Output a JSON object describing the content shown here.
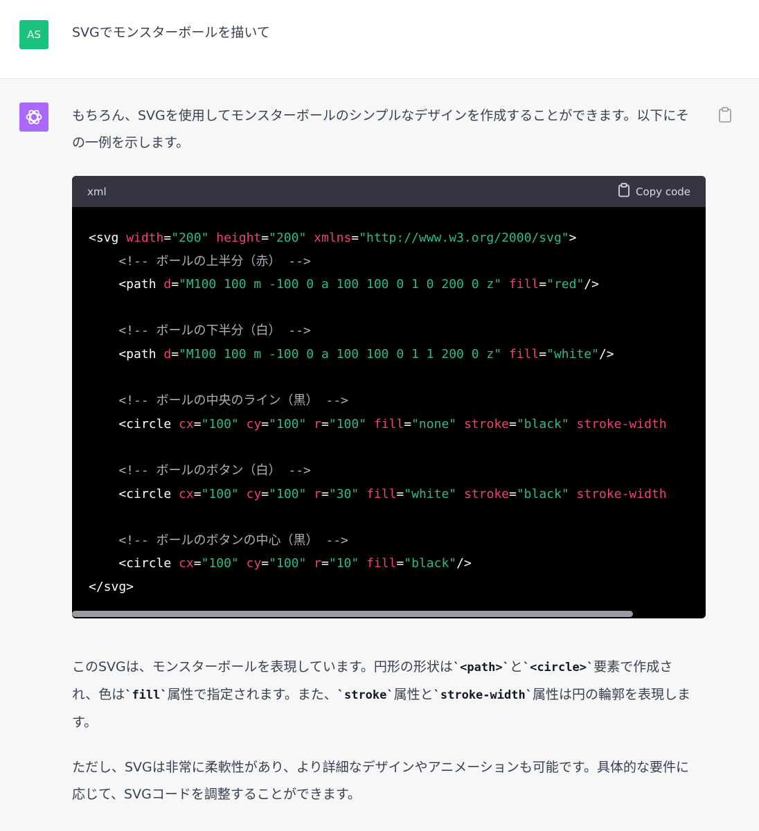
{
  "user": {
    "initials": "AS",
    "message": "SVGでモンスターボールを描いて"
  },
  "assistant": {
    "intro": "もちろん、SVGを使用してモンスターボールのシンプルなデザインを作成することができます。以下にその一例を示します。",
    "code_block": {
      "language": "xml",
      "copy_label": "Copy code"
    },
    "para2_parts": [
      "このSVGは、モンスターボールを表現しています。円形の形状は",
      "`<path>`",
      "と",
      "`<circle>`",
      "要素で作成され、色は",
      "`fill`",
      "属性で指定されます。また、",
      "`stroke`",
      "属性と",
      "`stroke-width`",
      "属性は円の輪郭を表現します。"
    ],
    "para3": "ただし、SVGは非常に柔軟性があり、より詳細なデザインやアニメーションも可能です。具体的な要件に応じて、SVGコードを調整することができます。"
  },
  "code_lines": [
    [
      [
        "tag",
        "<svg "
      ],
      [
        "attr",
        "width"
      ],
      [
        "tag",
        "="
      ],
      [
        "str",
        "\"200\""
      ],
      [
        "tag",
        " "
      ],
      [
        "attr",
        "height"
      ],
      [
        "tag",
        "="
      ],
      [
        "str",
        "\"200\""
      ],
      [
        "tag",
        " "
      ],
      [
        "attr",
        "xmlns"
      ],
      [
        "tag",
        "="
      ],
      [
        "str",
        "\"http://www.w3.org/2000/svg\""
      ],
      [
        "tag",
        ">"
      ]
    ],
    [
      [
        "cmt",
        "    <!-- ボールの上半分（赤） -->"
      ]
    ],
    [
      [
        "tag",
        "    <path "
      ],
      [
        "attr",
        "d"
      ],
      [
        "tag",
        "="
      ],
      [
        "str",
        "\"M100 100 m -100 0 a 100 100 0 1 0 200 0 z\""
      ],
      [
        "tag",
        " "
      ],
      [
        "attr",
        "fill"
      ],
      [
        "tag",
        "="
      ],
      [
        "str",
        "\"red\""
      ],
      [
        "tag",
        "/>"
      ]
    ],
    [],
    [
      [
        "cmt",
        "    <!-- ボールの下半分（白） -->"
      ]
    ],
    [
      [
        "tag",
        "    <path "
      ],
      [
        "attr",
        "d"
      ],
      [
        "tag",
        "="
      ],
      [
        "str",
        "\"M100 100 m -100 0 a 100 100 0 1 1 200 0 z\""
      ],
      [
        "tag",
        " "
      ],
      [
        "attr",
        "fill"
      ],
      [
        "tag",
        "="
      ],
      [
        "str",
        "\"white\""
      ],
      [
        "tag",
        "/>"
      ]
    ],
    [],
    [
      [
        "cmt",
        "    <!-- ボールの中央のライン（黒） -->"
      ]
    ],
    [
      [
        "tag",
        "    <circle "
      ],
      [
        "attr",
        "cx"
      ],
      [
        "tag",
        "="
      ],
      [
        "str",
        "\"100\""
      ],
      [
        "tag",
        " "
      ],
      [
        "attr",
        "cy"
      ],
      [
        "tag",
        "="
      ],
      [
        "str",
        "\"100\""
      ],
      [
        "tag",
        " "
      ],
      [
        "attr",
        "r"
      ],
      [
        "tag",
        "="
      ],
      [
        "str",
        "\"100\""
      ],
      [
        "tag",
        " "
      ],
      [
        "attr",
        "fill"
      ],
      [
        "tag",
        "="
      ],
      [
        "str",
        "\"none\""
      ],
      [
        "tag",
        " "
      ],
      [
        "attr",
        "stroke"
      ],
      [
        "tag",
        "="
      ],
      [
        "str",
        "\"black\""
      ],
      [
        "tag",
        " "
      ],
      [
        "attr",
        "stroke-width"
      ]
    ],
    [],
    [
      [
        "cmt",
        "    <!-- ボールのボタン（白） -->"
      ]
    ],
    [
      [
        "tag",
        "    <circle "
      ],
      [
        "attr",
        "cx"
      ],
      [
        "tag",
        "="
      ],
      [
        "str",
        "\"100\""
      ],
      [
        "tag",
        " "
      ],
      [
        "attr",
        "cy"
      ],
      [
        "tag",
        "="
      ],
      [
        "str",
        "\"100\""
      ],
      [
        "tag",
        " "
      ],
      [
        "attr",
        "r"
      ],
      [
        "tag",
        "="
      ],
      [
        "str",
        "\"30\""
      ],
      [
        "tag",
        " "
      ],
      [
        "attr",
        "fill"
      ],
      [
        "tag",
        "="
      ],
      [
        "str",
        "\"white\""
      ],
      [
        "tag",
        " "
      ],
      [
        "attr",
        "stroke"
      ],
      [
        "tag",
        "="
      ],
      [
        "str",
        "\"black\""
      ],
      [
        "tag",
        " "
      ],
      [
        "attr",
        "stroke-width"
      ]
    ],
    [],
    [
      [
        "cmt",
        "    <!-- ボールのボタンの中心（黒） -->"
      ]
    ],
    [
      [
        "tag",
        "    <circle "
      ],
      [
        "attr",
        "cx"
      ],
      [
        "tag",
        "="
      ],
      [
        "str",
        "\"100\""
      ],
      [
        "tag",
        " "
      ],
      [
        "attr",
        "cy"
      ],
      [
        "tag",
        "="
      ],
      [
        "str",
        "\"100\""
      ],
      [
        "tag",
        " "
      ],
      [
        "attr",
        "r"
      ],
      [
        "tag",
        "="
      ],
      [
        "str",
        "\"10\""
      ],
      [
        "tag",
        " "
      ],
      [
        "attr",
        "fill"
      ],
      [
        "tag",
        "="
      ],
      [
        "str",
        "\"black\""
      ],
      [
        "tag",
        "/>"
      ]
    ],
    [
      [
        "tag",
        "</svg>"
      ]
    ]
  ],
  "colors": {
    "user_avatar": "#19c37d",
    "bot_avatar": "#ab68ff",
    "code_bg": "#000000",
    "code_header_bg": "#343541",
    "attr": "#ef3e7f",
    "string": "#2fb98a",
    "comment": "#aeb0b6"
  },
  "icons": {
    "bot_avatar": "openai-logo-icon",
    "copy_message": "clipboard-icon",
    "copy_code": "clipboard-icon"
  }
}
